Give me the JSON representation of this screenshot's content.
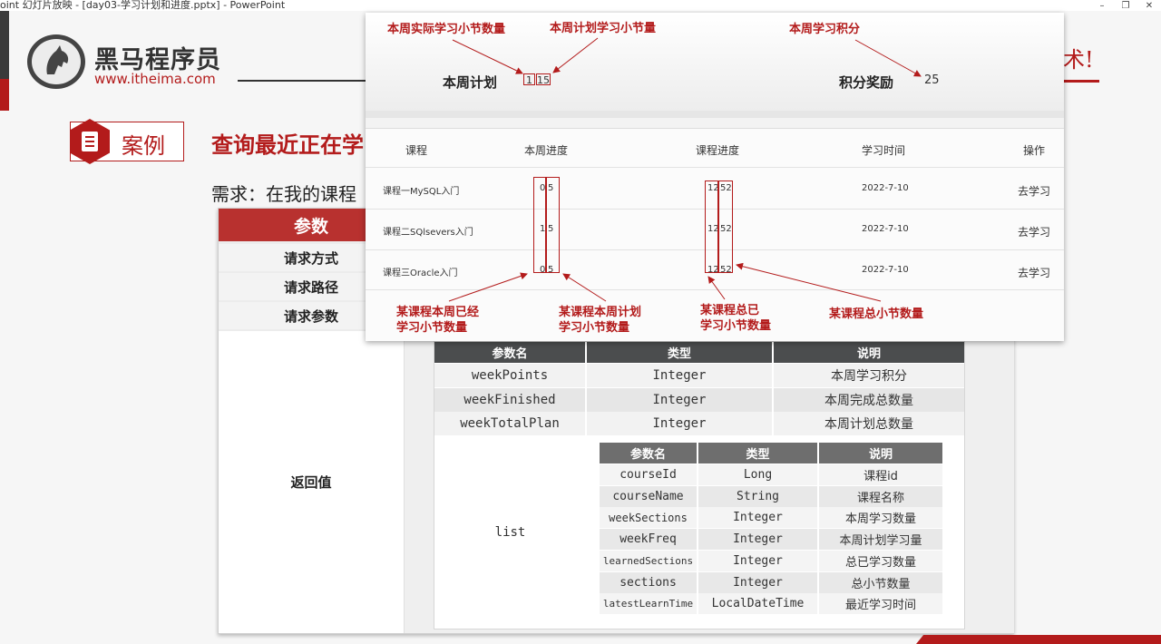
{
  "window": {
    "title": "oint 幻灯片放映 - [day03-学习计划和进度.pptx] - PowerPoint",
    "btn_min": "–",
    "btn_max": "❐",
    "btn_close": "✕"
  },
  "logo": {
    "name": "黑马程序员",
    "url": "www.itheima.com"
  },
  "slogan_tail": "术!",
  "case_badge": "案例",
  "case_title": "查询最近正在学",
  "requirement": "需求：在我的课程",
  "params_table": {
    "header": "参数",
    "rows": [
      "请求方式",
      "请求路径",
      "请求参数"
    ],
    "return_label": "返回值"
  },
  "return_table": {
    "headers": [
      "参数名",
      "类型",
      "说明"
    ],
    "rows": [
      {
        "name": "weekPoints",
        "type": "Integer",
        "desc": "本周学习积分"
      },
      {
        "name": "weekFinished",
        "type": "Integer",
        "desc": "本周完成总数量"
      },
      {
        "name": "weekTotalPlan",
        "type": "Integer",
        "desc": "本周计划总数量"
      }
    ],
    "list_name": "list",
    "nested": {
      "headers": [
        "参数名",
        "类型",
        "说明"
      ],
      "rows": [
        {
          "name": "courseId",
          "type": "Long",
          "desc": "课程id"
        },
        {
          "name": "courseName",
          "type": "String",
          "desc": "课程名称"
        },
        {
          "name": "weekSections",
          "type": "Integer",
          "desc": "本周学习数量"
        },
        {
          "name": "weekFreq",
          "type": "Integer",
          "desc": "本周计划学习量"
        },
        {
          "name": "learnedSections",
          "type": "Integer",
          "desc": "总已学习数量"
        },
        {
          "name": "sections",
          "type": "Integer",
          "desc": "总小节数量"
        },
        {
          "name": "latestLearnTime",
          "type": "LocalDateTime",
          "desc": "最近学习时间"
        }
      ]
    }
  },
  "overlay": {
    "annotations": {
      "week_actual": "本周实际学习小节数量",
      "week_plan": "本周计划学习小节量",
      "week_points": "本周学习积分",
      "course_week_learned_1": "某课程本周已经",
      "course_week_learned_2": "学习小节数量",
      "course_week_plan_1": "某课程本周计划",
      "course_week_plan_2": "学习小节数量",
      "course_total_learned_1": "某课程总已",
      "course_total_learned_2": "学习小节数量",
      "course_total_sections": "某课程总小节数量"
    },
    "plan_label": "本周计划",
    "plan_done": "1",
    "plan_total": "15",
    "points_label": "积分奖励",
    "points_value": "25",
    "table_headers": [
      "课程",
      "本周进度",
      "课程进度",
      "学习时间",
      "操作"
    ],
    "courses": [
      {
        "name": "课程一MySQL入门",
        "week_done": "0",
        "week_plan": "5",
        "learned": "12",
        "total": "52",
        "time": "2022-7-10",
        "action": "去学习"
      },
      {
        "name": "课程二SQlsevers入门",
        "week_done": "1",
        "week_plan": "5",
        "learned": "12",
        "total": "52",
        "time": "2022-7-10",
        "action": "去学习"
      },
      {
        "name": "课程三Oracle入门",
        "week_done": "0",
        "week_plan": "5",
        "learned": "12",
        "total": "52",
        "time": "2022-7-10",
        "action": "去学习"
      }
    ]
  },
  "colors": {
    "accent": "#b31b1b",
    "header_dark": "#4b4d4e",
    "table_red": "#b8312f"
  }
}
